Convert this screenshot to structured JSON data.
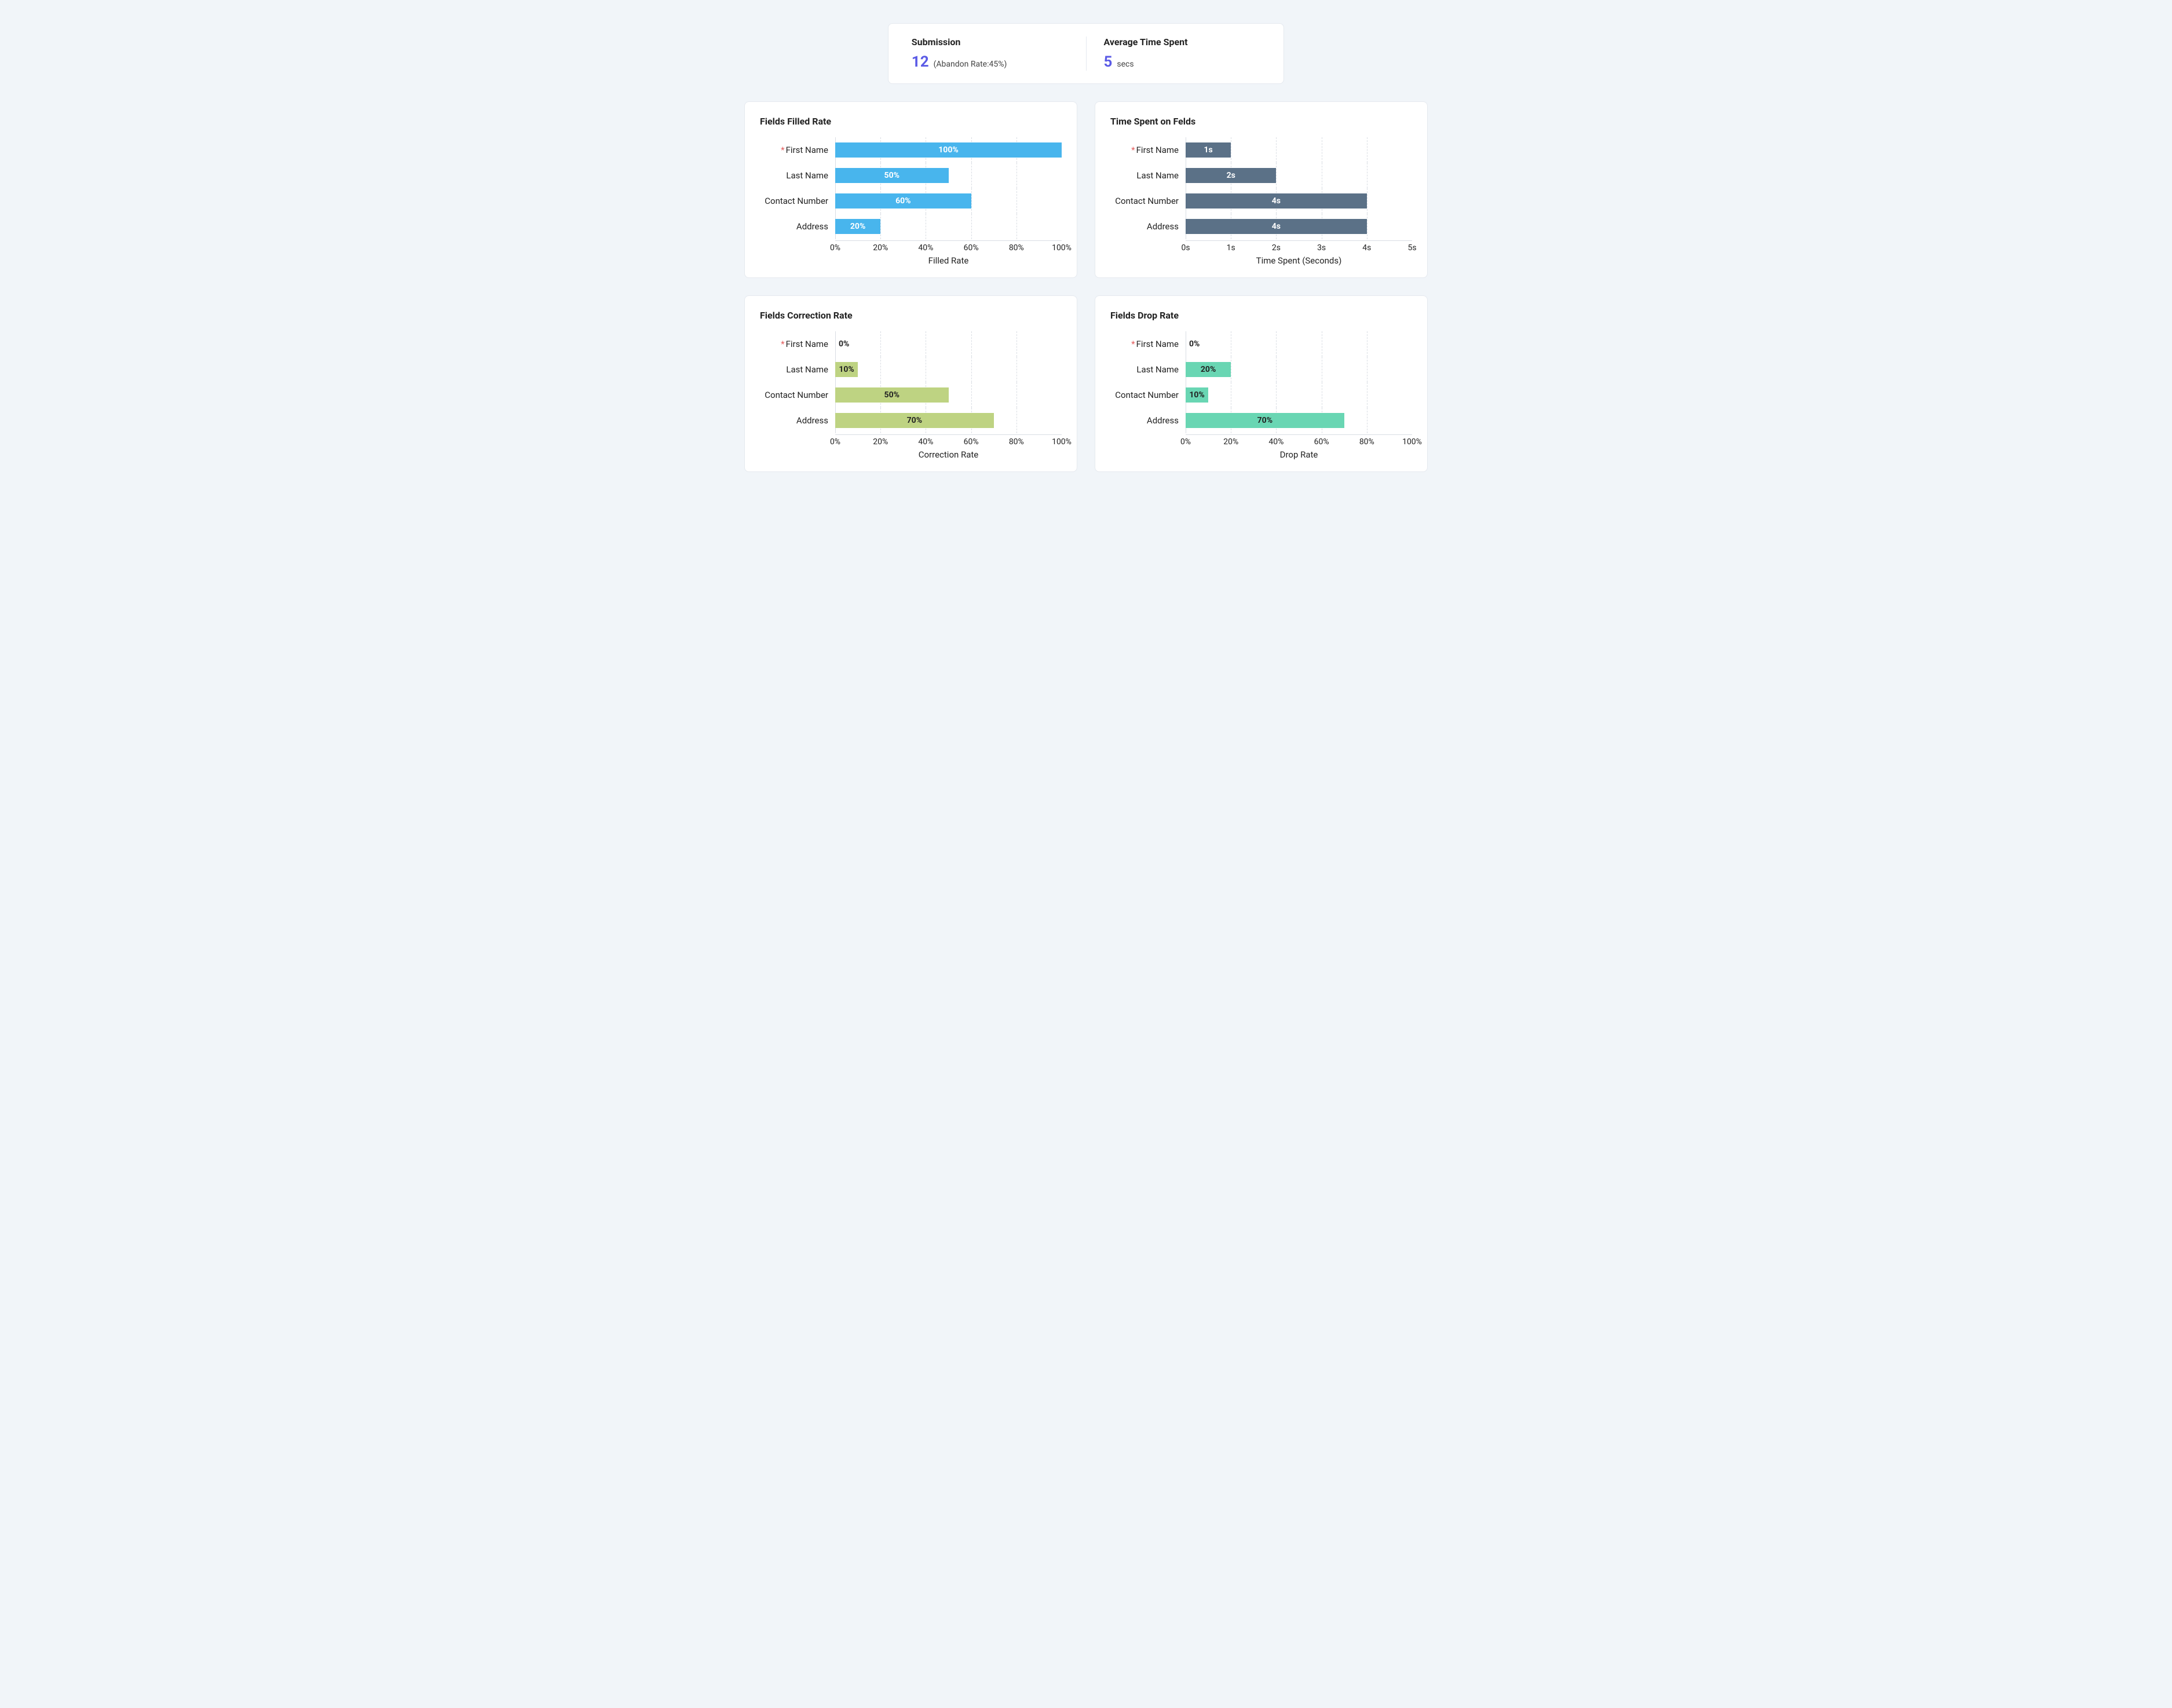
{
  "summary": {
    "submission_label": "Submission",
    "submission_value": "12",
    "submission_sub": "(Abandon Rate:45%)",
    "avg_time_label": "Average Time Spent",
    "avg_time_value": "5",
    "avg_time_unit": "secs"
  },
  "charts": {
    "filled": {
      "title": "Fields Filled Rate",
      "xlabel": "Filled Rate",
      "ticks": [
        "0%",
        "20%",
        "40%",
        "60%",
        "80%",
        "100%"
      ]
    },
    "time": {
      "title": "Time Spent on Felds",
      "xlabel": "Time Spent (Seconds)",
      "ticks": [
        "0s",
        "1s",
        "2s",
        "3s",
        "4s",
        "5s"
      ]
    },
    "correction": {
      "title": "Fields Correction Rate",
      "xlabel": "Correction Rate",
      "ticks": [
        "0%",
        "20%",
        "40%",
        "60%",
        "80%",
        "100%"
      ]
    },
    "drop": {
      "title": "Fields Drop Rate",
      "xlabel": "Drop Rate",
      "ticks": [
        "0%",
        "20%",
        "40%",
        "60%",
        "80%",
        "100%"
      ]
    }
  },
  "fields": {
    "first_name": {
      "label": "First Name",
      "required": true
    },
    "last_name": {
      "label": "Last Name",
      "required": false
    },
    "contact_number": {
      "label": "Contact Number",
      "required": false
    },
    "address": {
      "label": "Address",
      "required": false
    }
  },
  "values": {
    "filled": {
      "first_name": "100%",
      "last_name": "50%",
      "contact_number": "60%",
      "address": "20%"
    },
    "time": {
      "first_name": "1s",
      "last_name": "2s",
      "contact_number": "4s",
      "address": "4s"
    },
    "correction": {
      "first_name": "0%",
      "last_name": "10%",
      "contact_number": "50%",
      "address": "70%"
    },
    "drop": {
      "first_name": "0%",
      "last_name": "20%",
      "contact_number": "10%",
      "address": "70%"
    }
  },
  "chart_data": [
    {
      "type": "bar",
      "orientation": "horizontal",
      "title": "Fields Filled Rate",
      "xlabel": "Filled Rate",
      "categories": [
        "First Name",
        "Last Name",
        "Contact Number",
        "Address"
      ],
      "values": [
        100,
        50,
        60,
        20
      ],
      "unit": "%",
      "xlim": [
        0,
        100
      ]
    },
    {
      "type": "bar",
      "orientation": "horizontal",
      "title": "Time Spent on Felds",
      "xlabel": "Time Spent (Seconds)",
      "categories": [
        "First Name",
        "Last Name",
        "Contact Number",
        "Address"
      ],
      "values": [
        1,
        2,
        4,
        4
      ],
      "unit": "s",
      "xlim": [
        0,
        5
      ]
    },
    {
      "type": "bar",
      "orientation": "horizontal",
      "title": "Fields Correction Rate",
      "xlabel": "Correction Rate",
      "categories": [
        "First Name",
        "Last Name",
        "Contact Number",
        "Address"
      ],
      "values": [
        0,
        10,
        50,
        70
      ],
      "unit": "%",
      "xlim": [
        0,
        100
      ]
    },
    {
      "type": "bar",
      "orientation": "horizontal",
      "title": "Fields Drop Rate",
      "xlabel": "Drop Rate",
      "categories": [
        "First Name",
        "Last Name",
        "Contact Number",
        "Address"
      ],
      "values": [
        0,
        20,
        10,
        70
      ],
      "unit": "%",
      "xlim": [
        0,
        100
      ]
    }
  ]
}
